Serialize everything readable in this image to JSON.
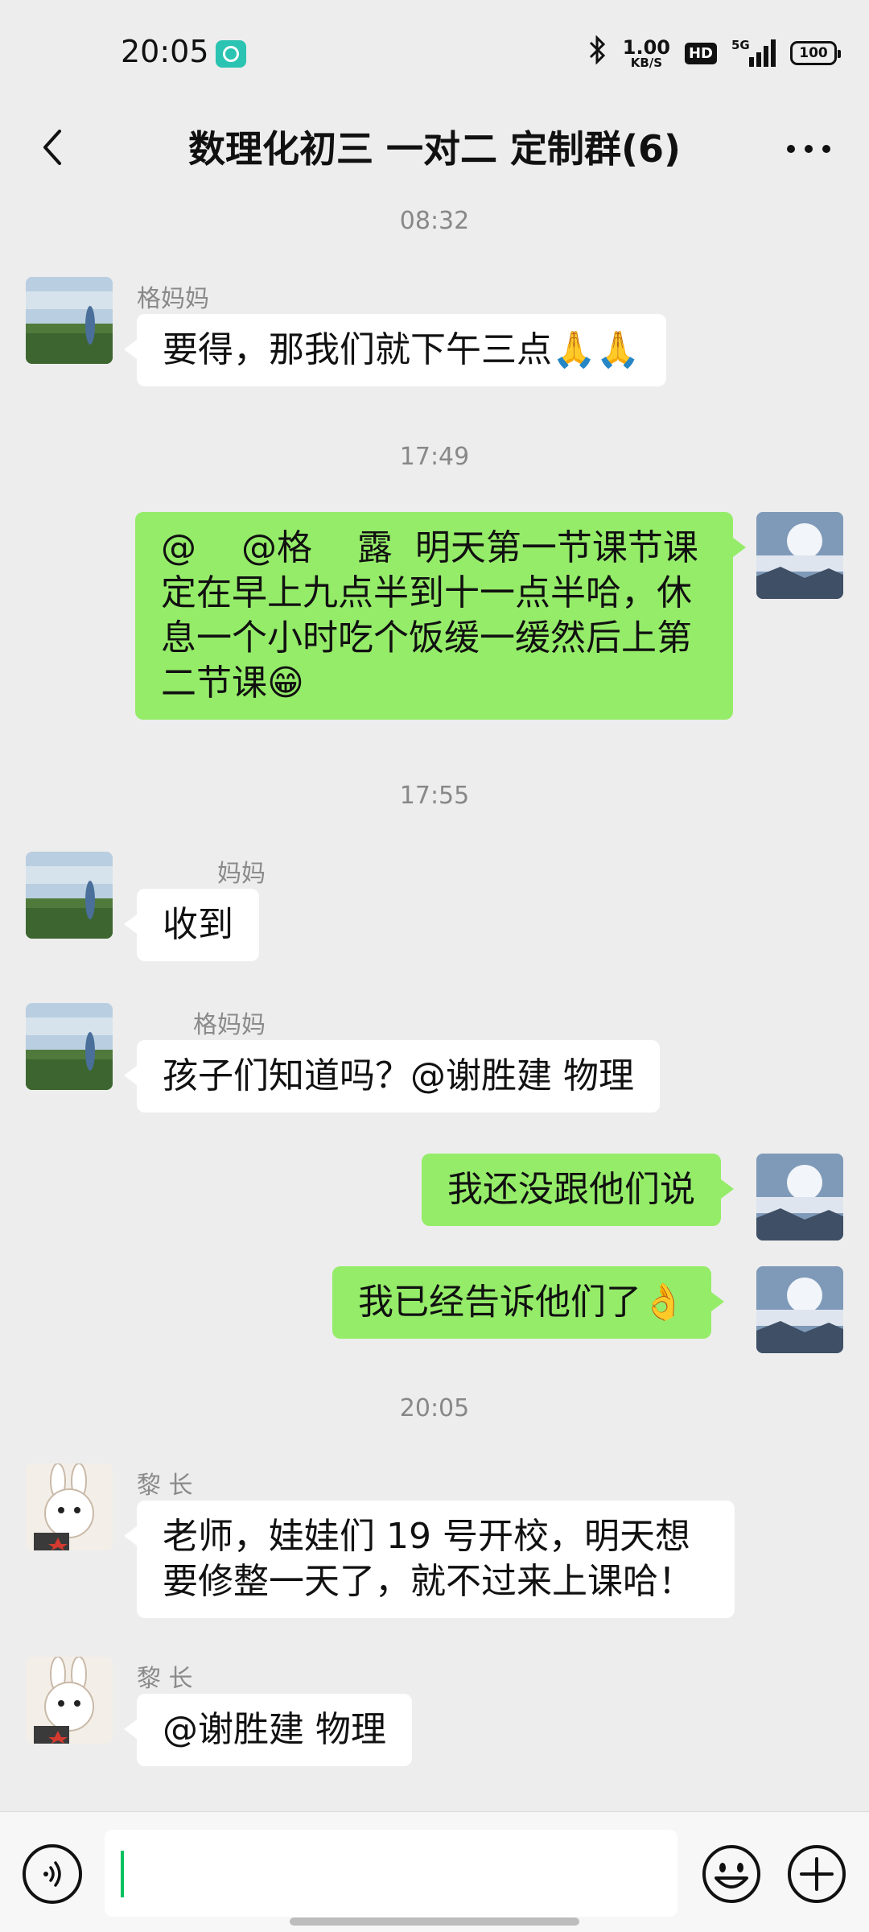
{
  "status_bar": {
    "time": "20:05",
    "net_speed_value": "1.00",
    "net_speed_unit": "KB/S",
    "hd_label": "HD",
    "network_label": "5G",
    "battery": "100"
  },
  "header": {
    "title": "数理化初三 一对二 定制群(6)"
  },
  "messages": [
    {
      "time": "08:32"
    },
    {
      "sender": "格妈妈",
      "text": "要得，那我们就下午三点🙏🙏"
    },
    {
      "time": "17:49"
    },
    {
      "text": "@    @格    露  明天第一节课节课定在早上九点半到十一点半哈，休息一个小时吃个饭缓一缓然后上第二节课😁"
    },
    {
      "time": "17:55"
    },
    {
      "sender": "妈妈",
      "text": "收到"
    },
    {
      "sender": "格妈妈",
      "text": "孩子们知道吗？@谢胜建 物理"
    },
    {
      "text": "我还没跟他们说"
    },
    {
      "text": "我已经告诉他们了👌"
    },
    {
      "time": "20:05"
    },
    {
      "sender": "黎    长",
      "text": "老师，娃娃们 19 号开校，明天想要修整一天了，就不过来上课哈！"
    },
    {
      "sender": "黎    长",
      "text": "@谢胜建 物理"
    }
  ],
  "input": {
    "value": ""
  },
  "colors": {
    "background": "#ededed",
    "outgoing_bubble": "#95ec69",
    "incoming_bubble": "#ffffff",
    "caret": "#07c160"
  },
  "icons": [
    "back-arrow-icon",
    "more-icon",
    "voice-icon",
    "emoji-icon",
    "plus-icon",
    "bluetooth-icon",
    "signal-icon",
    "battery-icon"
  ]
}
